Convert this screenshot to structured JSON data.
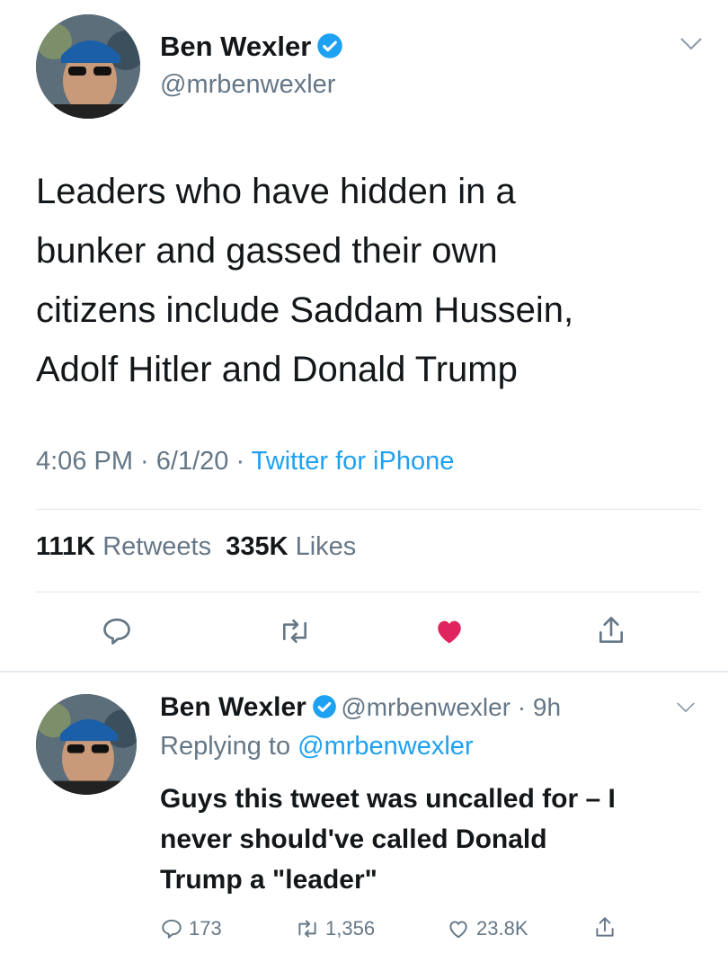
{
  "main_tweet": {
    "author_name": "Ben Wexler",
    "handle": "@mrbenwexler",
    "text_lines": [
      "Leaders who have hidden in a",
      "bunker and gassed their own",
      "citizens include Saddam Hussein,",
      "Adolf Hitler and Donald Trump"
    ],
    "time": "4:06 PM",
    "date": "6/1/20",
    "source": "Twitter for iPhone",
    "retweets_count": "111K",
    "retweets_label": "Retweets",
    "likes_count": "335K",
    "likes_label": "Likes",
    "actions": [
      "reply-icon",
      "retweet-icon",
      "heart-icon",
      "share-icon"
    ]
  },
  "reply_tweet": {
    "author_name": "Ben Wexler",
    "handle": "@mrbenwexler",
    "time_ago": "9h",
    "replying_label": "Replying to",
    "replying_handle": "@mrbenwexler",
    "text_lines": [
      "Guys this tweet was uncalled for – I",
      "never should've called Donald",
      "Trump a \"leader\""
    ],
    "reply_count": "173",
    "retweet_count": "1,356",
    "like_count": "23.8K"
  },
  "colors": {
    "accent": "#1da1f2",
    "like": "#e0245e",
    "secondary_text": "#657786"
  }
}
